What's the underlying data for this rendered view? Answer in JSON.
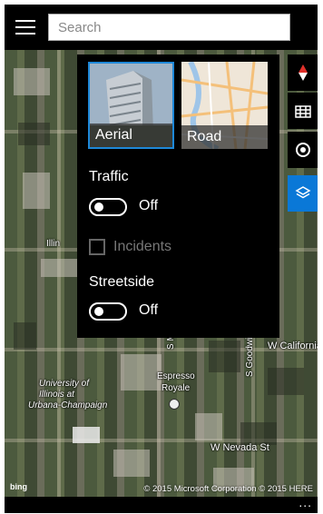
{
  "search": {
    "placeholder": "Search"
  },
  "map": {
    "labels": {
      "university": "University of",
      "university2": "Illinois at",
      "university3": "Urbana-Champaign",
      "espresso": "Espresso",
      "royale": "Royale",
      "california": "W California",
      "nevada": "W Nevada St",
      "goodwin": "S Goodwin Ave",
      "mathews": "S Mathews Ave",
      "illinois": "Illin",
      "copyright": "© 2015 Microsoft Corporation  © 2015 HERE",
      "bing": "bing"
    }
  },
  "panel": {
    "tiles": [
      {
        "label": "Aerial",
        "selected": true
      },
      {
        "label": "Road",
        "selected": false
      }
    ],
    "traffic": {
      "label": "Traffic",
      "state": "Off"
    },
    "incidents": {
      "label": "Incidents"
    },
    "streetside": {
      "label": "Streetside",
      "state": "Off"
    }
  },
  "side_buttons": [
    "compass-icon",
    "buildings-icon",
    "location-icon",
    "layers-icon"
  ],
  "bottom": {
    "more": "..."
  },
  "colors": {
    "accent": "#0a78d7",
    "selected_border": "#1e88d8"
  }
}
